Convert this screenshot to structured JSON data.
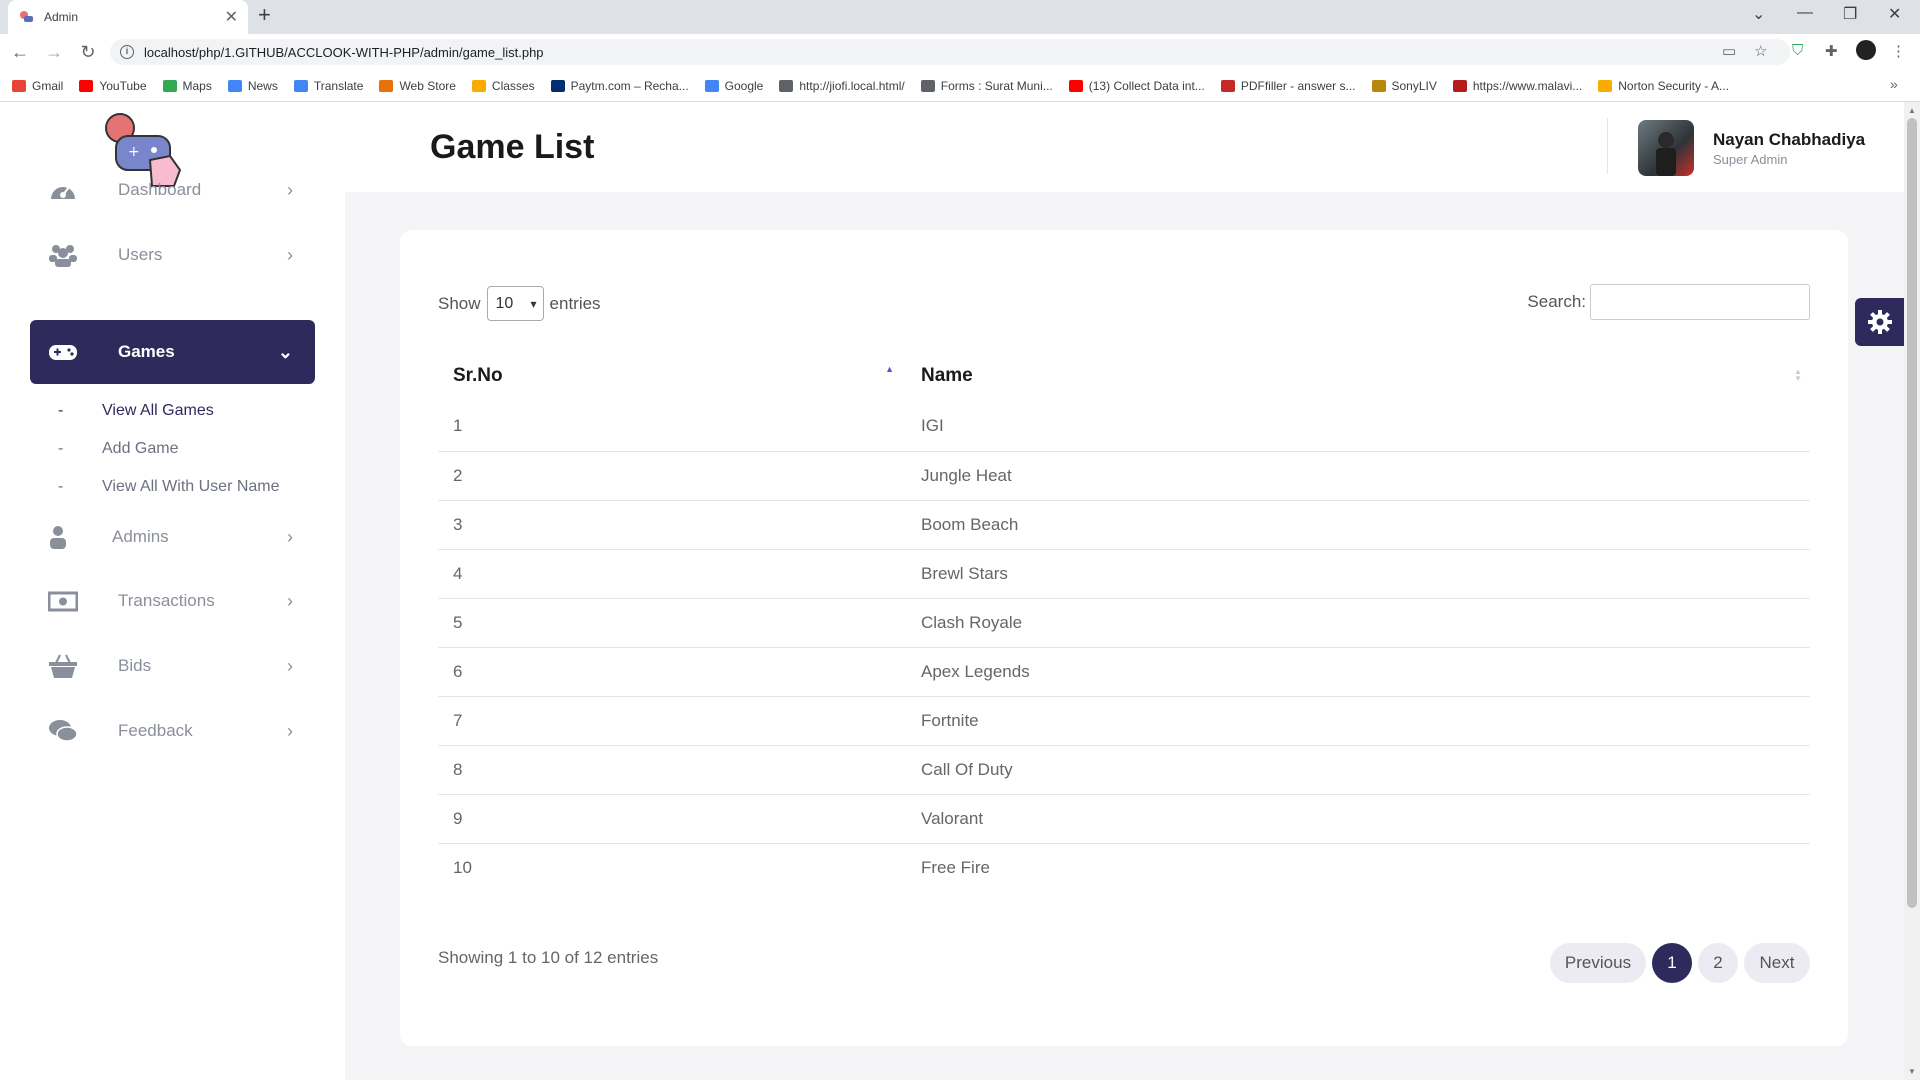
{
  "browser": {
    "tab_title": "Admin",
    "new_tab": "+",
    "url": "localhost/php/1.GITHUB/ACCLOOK-WITH-PHP/admin/game_list.php",
    "bookmarks": [
      {
        "label": "Gmail",
        "icon": "gmail-icon",
        "color": "#ea4335"
      },
      {
        "label": "YouTube",
        "icon": "youtube-icon",
        "color": "#ff0000"
      },
      {
        "label": "Maps",
        "icon": "maps-icon",
        "color": "#34a853"
      },
      {
        "label": "News",
        "icon": "news-icon",
        "color": "#4285f4"
      },
      {
        "label": "Translate",
        "icon": "translate-icon",
        "color": "#4285f4"
      },
      {
        "label": "Web Store",
        "icon": "web-store-icon",
        "color": "#e8710a"
      },
      {
        "label": "Classes",
        "icon": "classes-icon",
        "color": "#f9ab00"
      },
      {
        "label": "Paytm.com – Recha...",
        "icon": "paytm-icon",
        "color": "#002e6e"
      },
      {
        "label": "Google",
        "icon": "google-icon",
        "color": "#4285f4"
      },
      {
        "label": "http://jiofi.local.html/",
        "icon": "globe-icon",
        "color": "#5f6368"
      },
      {
        "label": "Forms : Surat Muni...",
        "icon": "forms-icon",
        "color": "#5f6368"
      },
      {
        "label": "(13) Collect Data int...",
        "icon": "youtube-icon",
        "color": "#ff0000"
      },
      {
        "label": "PDFfiller - answer s...",
        "icon": "pdffiller-icon",
        "color": "#c62828"
      },
      {
        "label": "SonyLIV",
        "icon": "sonyliv-icon",
        "color": "#b8860b"
      },
      {
        "label": "https://www.malavi...",
        "icon": "malavi-icon",
        "color": "#b71c1c"
      },
      {
        "label": "Norton Security - A...",
        "icon": "norton-icon",
        "color": "#f9ab00"
      }
    ]
  },
  "sidebar": {
    "items": [
      {
        "label": "Dashboard",
        "icon": "dashboard-icon"
      },
      {
        "label": "Users",
        "icon": "users-icon"
      },
      {
        "label": "Games",
        "icon": "gamepad-icon"
      },
      {
        "label": "Admins",
        "icon": "user-icon"
      },
      {
        "label": "Transactions",
        "icon": "money-icon"
      },
      {
        "label": "Bids",
        "icon": "basket-icon"
      },
      {
        "label": "Feedback",
        "icon": "comments-icon"
      }
    ],
    "submenu": [
      {
        "label": "View All Games"
      },
      {
        "label": "Add Game"
      },
      {
        "label": "View All With User Name"
      }
    ],
    "dash": "-"
  },
  "header": {
    "title": "Game List",
    "user_name": "Nayan Chabhadiya",
    "user_role": "Super Admin"
  },
  "table_controls": {
    "show_label": "Show",
    "entries_value": "10",
    "entries_label": "entries",
    "search_label": "Search:"
  },
  "table": {
    "columns": [
      "Sr.No",
      "Name"
    ],
    "rows": [
      {
        "no": "1",
        "name": "IGI"
      },
      {
        "no": "2",
        "name": "Jungle Heat"
      },
      {
        "no": "3",
        "name": "Boom Beach"
      },
      {
        "no": "4",
        "name": "Brewl Stars"
      },
      {
        "no": "5",
        "name": "Clash Royale"
      },
      {
        "no": "6",
        "name": "Apex Legends"
      },
      {
        "no": "7",
        "name": "Fortnite"
      },
      {
        "no": "8",
        "name": "Call Of Duty"
      },
      {
        "no": "9",
        "name": "Valorant"
      },
      {
        "no": "10",
        "name": "Free Fire"
      }
    ]
  },
  "footer": {
    "info": "Showing 1 to 10 of 12 entries",
    "previous": "Previous",
    "pages": [
      "1",
      "2"
    ],
    "next": "Next"
  },
  "colors": {
    "accent": "#2e2a5c",
    "content_bg": "#f5f5f8"
  }
}
